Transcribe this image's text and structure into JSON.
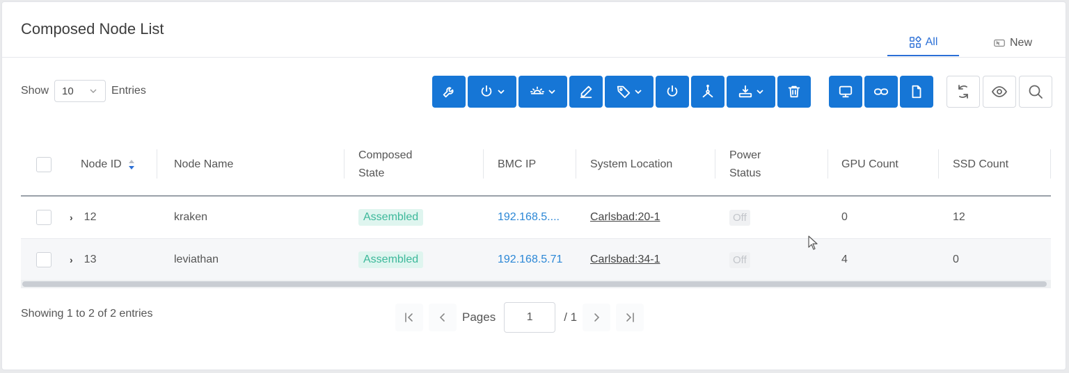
{
  "header": {
    "title": "Composed Node List",
    "tabs": [
      {
        "label": "All",
        "icon": "grid-icon",
        "active": true
      },
      {
        "label": "New",
        "icon": "new-badge-icon",
        "active": false
      }
    ]
  },
  "show": {
    "prefix": "Show",
    "value": "10",
    "suffix": "Entries"
  },
  "toolbar": {
    "primary": [
      {
        "name": "maintenance-button",
        "icon": "wrench-icon",
        "dropdown": false
      },
      {
        "name": "power-menu-button",
        "icon": "power-icon",
        "dropdown": true
      },
      {
        "name": "led-menu-button",
        "icon": "light-icon",
        "dropdown": true
      },
      {
        "name": "edit-button",
        "icon": "pencil-icon",
        "dropdown": false
      },
      {
        "name": "tag-menu-button",
        "icon": "tag-icon",
        "dropdown": true
      },
      {
        "name": "power-button",
        "icon": "power-icon",
        "dropdown": false
      },
      {
        "name": "topology-button",
        "icon": "topology-icon",
        "dropdown": false
      },
      {
        "name": "deploy-menu-button",
        "icon": "download-tray-icon",
        "dropdown": true
      },
      {
        "name": "delete-button",
        "icon": "trash-icon",
        "dropdown": false
      }
    ],
    "secondary": [
      {
        "name": "console-button",
        "icon": "monitor-icon"
      },
      {
        "name": "link-button",
        "icon": "link-icon"
      },
      {
        "name": "document-button",
        "icon": "file-icon"
      }
    ],
    "outline": [
      {
        "name": "refresh-button",
        "icon": "refresh-icon"
      },
      {
        "name": "view-button",
        "icon": "eye-icon"
      },
      {
        "name": "search-button",
        "icon": "search-icon"
      }
    ]
  },
  "table": {
    "columns": {
      "node_id": "Node ID",
      "node_name": "Node Name",
      "composed_state_1": "Composed",
      "composed_state_2": "State",
      "bmc_ip": "BMC IP",
      "system_location": "System Location",
      "power_status_1": "Power",
      "power_status_2": "Status",
      "gpu_count": "GPU Count",
      "ssd_count": "SSD Count"
    },
    "rows": [
      {
        "id": "12",
        "name": "kraken",
        "state": "Assembled",
        "bmc_ip": "192.168.5....",
        "location": "Carlsbad:20-1",
        "power": "Off",
        "gpu": "0",
        "ssd": "12"
      },
      {
        "id": "13",
        "name": "leviathan",
        "state": "Assembled",
        "bmc_ip": "192.168.5.71",
        "location": "Carlsbad:34-1",
        "power": "Off",
        "gpu": "4",
        "ssd": "0"
      }
    ]
  },
  "footer": {
    "showing": "Showing 1 to 2 of 2 entries",
    "pages_label": "Pages",
    "current_page": "1",
    "total_pages": "/ 1"
  },
  "colors": {
    "primary": "#1676d6",
    "active_tab": "#2b6fd6",
    "assembled_bg": "#dff5ef",
    "assembled_text": "#3cb89a",
    "link": "#2b87d6"
  }
}
